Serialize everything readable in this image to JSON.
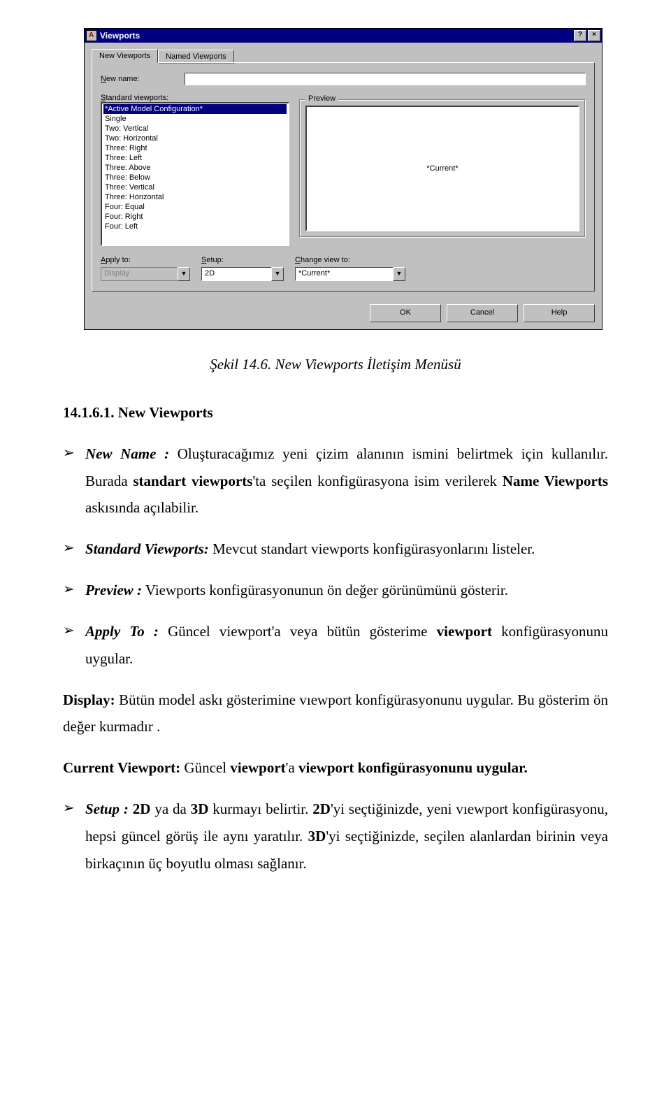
{
  "dialog": {
    "title": "Viewports",
    "win_buttons": {
      "help": "?",
      "close": "×"
    },
    "tabs": {
      "active": "New Viewports",
      "inactive": "Named Viewports"
    },
    "new_name_label": "New name:",
    "new_name_value": "",
    "standard_label": "Standard viewports:",
    "list_items": [
      "*Active Model Configuration*",
      "Single",
      "Two: Vertical",
      "Two: Horizontal",
      "Three: Right",
      "Three: Left",
      "Three: Above",
      "Three: Below",
      "Three: Vertical",
      "Three: Horizontal",
      "Four: Equal",
      "Four: Right",
      "Four: Left"
    ],
    "preview_label": "Preview",
    "preview_content": "*Current*",
    "apply_label": "Apply to:",
    "apply_value": "Display",
    "setup_label": "Setup:",
    "setup_value": "2D",
    "change_label": "Change view to:",
    "change_value": "*Current*",
    "buttons": {
      "ok": "OK",
      "cancel": "Cancel",
      "help": "Help"
    }
  },
  "doc": {
    "caption": "Şekil 14.6. New Viewports İletişim Menüsü",
    "heading": "14.1.6.1. New Viewports",
    "items": {
      "new_name_term": "New Name :",
      "new_name_body_a": " Oluşturacağımız yeni çizim alanının ismini belirtmek için kullanılır. Burada ",
      "new_name_body_b": "standart viewports",
      "new_name_body_c": "'ta seçilen konfigürasyona isim verilerek ",
      "new_name_body_d": "Name Viewports",
      "new_name_body_e": " askısında açılabilir.",
      "standard_term": "Standard Viewports:",
      "standard_body": " Mevcut standart viewports konfigürasyonlarını listeler.",
      "preview_term": "Preview :",
      "preview_body": " Viewports konfigürasyonunun ön değer görünümünü gösterir.",
      "apply_term": "Apply To :",
      "apply_body_a": " Güncel viewport'a veya bütün gösterime ",
      "apply_body_b": "viewport",
      "apply_body_c": " konfigürasyonunu uygular.",
      "setup_term": "Setup :",
      "setup_body_a": " ",
      "setup_body_b": "2D",
      "setup_body_c": " ya da ",
      "setup_body_d": "3D",
      "setup_body_e": " kurmayı belirtir. ",
      "setup_body_f": "2D",
      "setup_body_g": "'yi seçtiğinizde, yeni vıewport konfigürasyonu, hepsi güncel görüş ile aynı yaratılır. ",
      "setup_body_h": "3D",
      "setup_body_i": "'yi seçtiğinizde, seçilen alanlardan birinin veya birkaçının üç boyutlu olması sağlanır."
    },
    "para_display_a": "Display:",
    "para_display_b": " Bütün model askı gösterimine vıewport konfigürasyonunu  uygular. Bu gösterim ön değer kurmadır .",
    "para_current_a": "Current Viewport:",
    "para_current_b": " Güncel ",
    "para_current_c": "viewport",
    "para_current_d": "'a ",
    "para_current_e": "viewport konfigürasyonunu uygular."
  }
}
